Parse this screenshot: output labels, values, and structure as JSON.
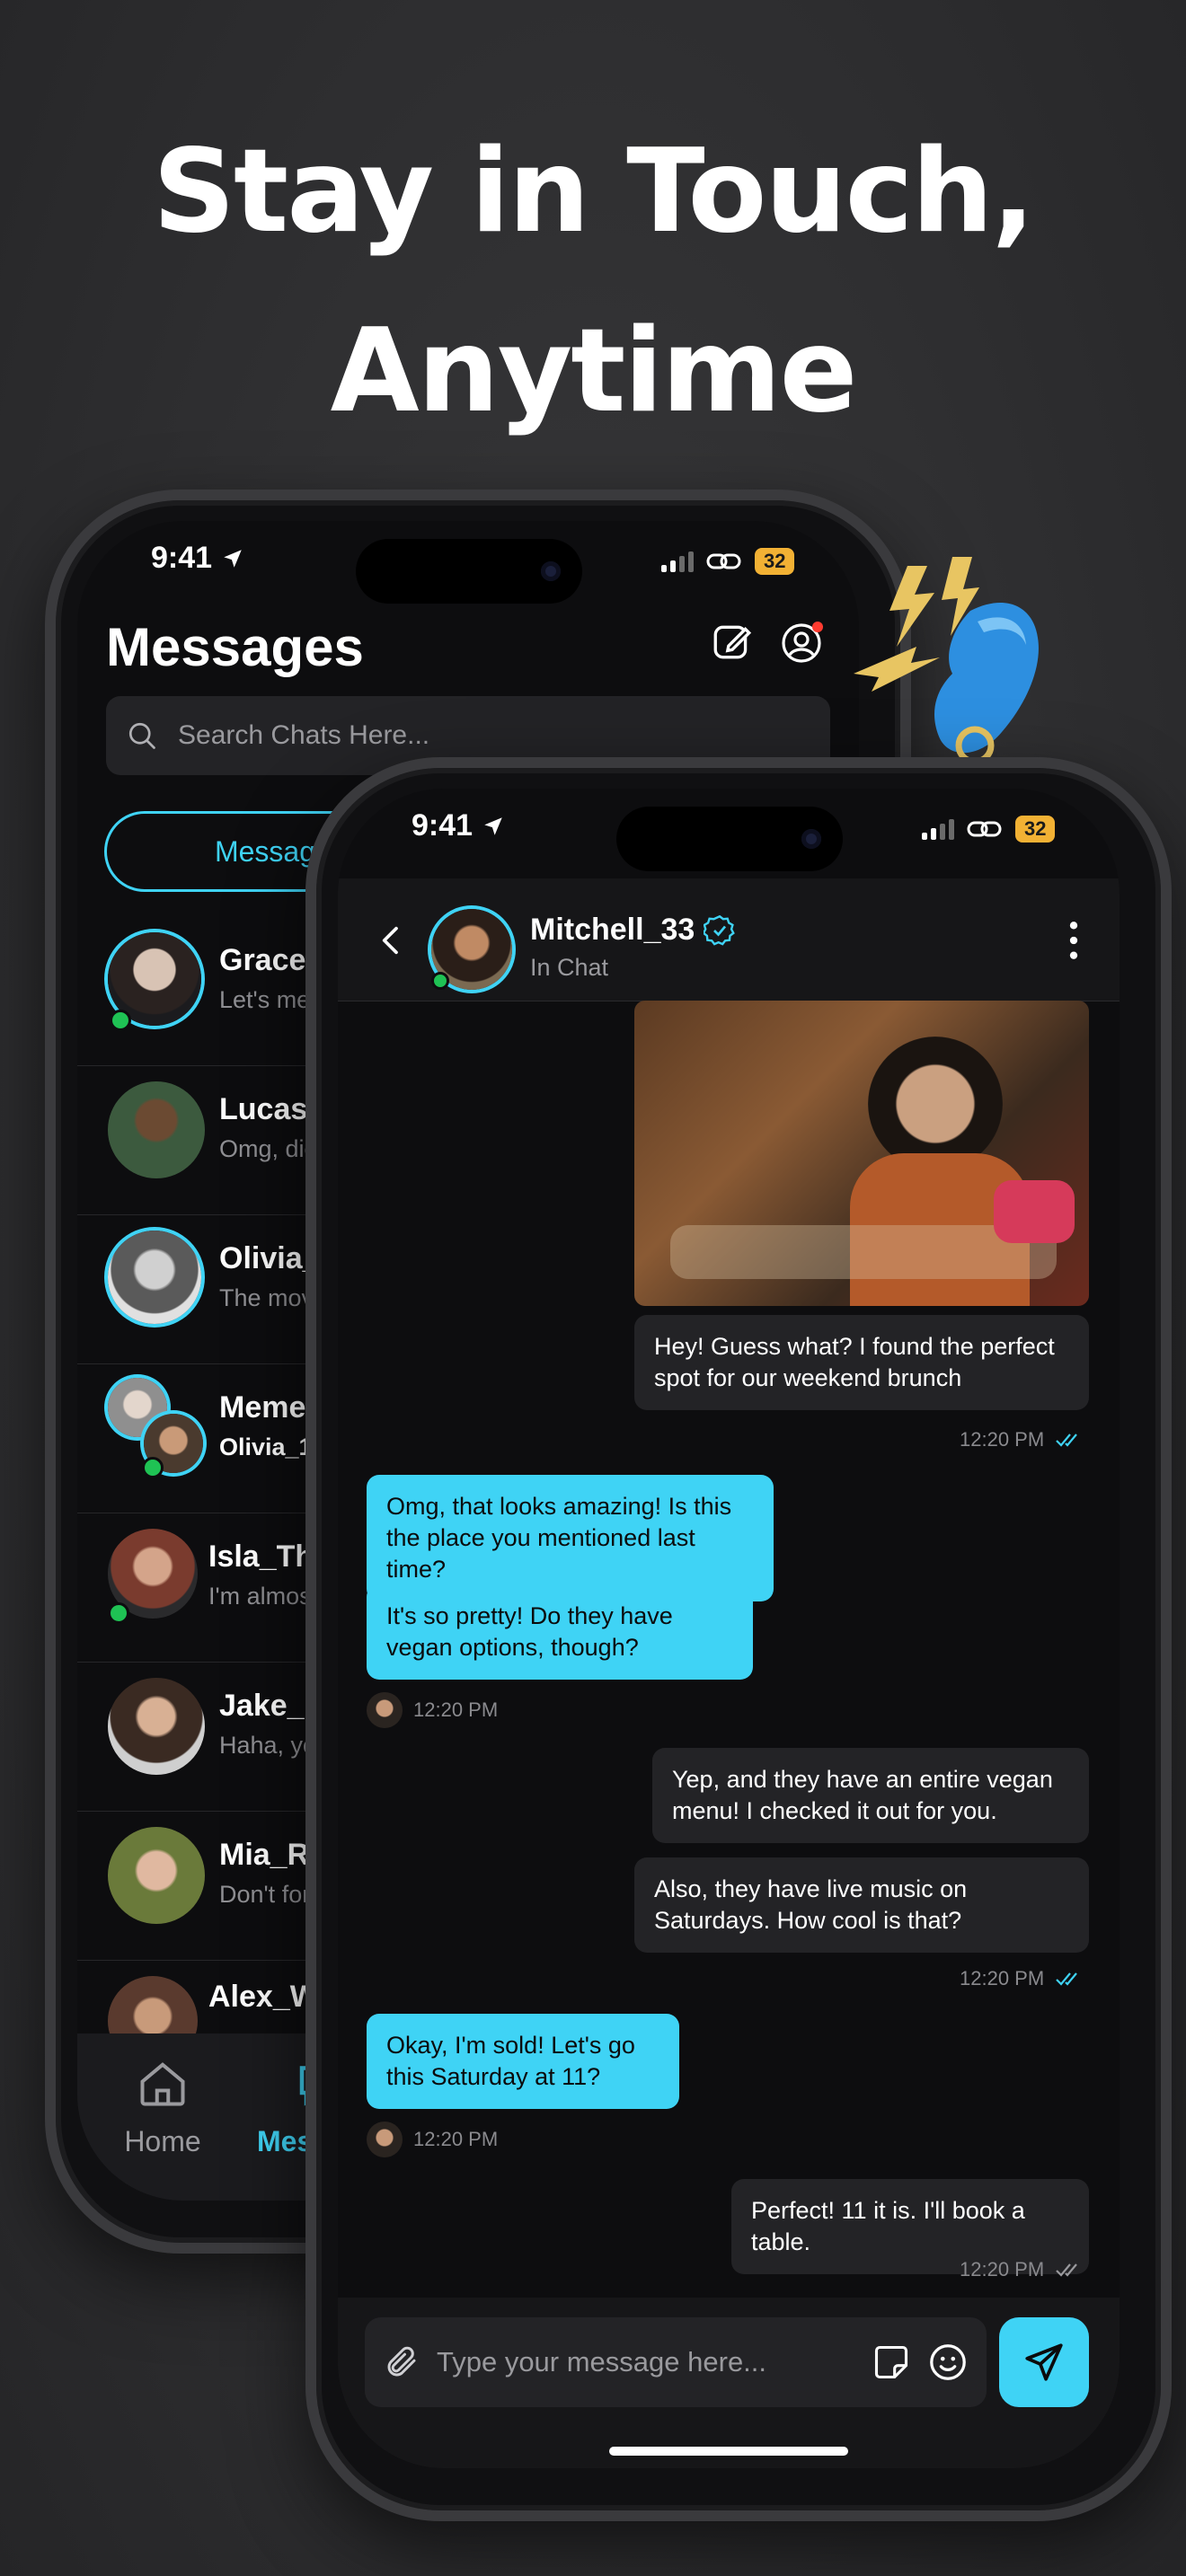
{
  "headline": {
    "line1": "Stay in Touch,",
    "line2": "Anytime"
  },
  "back_phone": {
    "status": {
      "time": "9:41",
      "battery": "32"
    },
    "title": "Messages",
    "search_placeholder": "Search Chats Here...",
    "filter_pill": "Messag",
    "chats": [
      {
        "name": "Grace_",
        "preview": "Let's me",
        "online": true
      },
      {
        "name": "Lucas_",
        "preview": "Omg, dic",
        "online": false
      },
      {
        "name": "Olivia_",
        "preview": "The mov",
        "online": false
      },
      {
        "name": "Meme",
        "preview": "Olivia_1",
        "online": true
      },
      {
        "name": "Isla_Th",
        "preview": "I'm almos",
        "online": true
      },
      {
        "name": "Jake_l",
        "preview": "Haha, yo",
        "online": false
      },
      {
        "name": "Mia_R",
        "preview": "Don't for",
        "online": false
      },
      {
        "name": "Alex_W",
        "preview": "",
        "online": false
      }
    ],
    "tabs": {
      "home": "Home",
      "messages": "Mes"
    }
  },
  "front_phone": {
    "status": {
      "time": "9:41",
      "battery": "32"
    },
    "contact": {
      "name": "Mitchell_33",
      "status": "In Chat"
    },
    "messages": [
      {
        "from": "them",
        "text": "Hey! Guess what? I found the perfect spot for our weekend brunch",
        "time": "12:20 PM"
      },
      {
        "from": "me",
        "text": "Omg, that looks amazing! Is this the place you mentioned last time?"
      },
      {
        "from": "me",
        "text": "It's so pretty! Do they have vegan options, though?",
        "time": "12:20 PM"
      },
      {
        "from": "them",
        "text": "Yep, and they have an entire vegan menu! I checked it out for you."
      },
      {
        "from": "them",
        "text": "Also, they have live music on Saturdays. How cool is that?",
        "time": "12:20 PM"
      },
      {
        "from": "me",
        "text": "Okay, I'm sold! Let's go this Saturday at 11?",
        "time": "12:20 PM"
      },
      {
        "from": "them",
        "text": "Perfect! 11 it is. I'll book a table.",
        "time": "12:20 PM"
      }
    ],
    "composer_placeholder": "Type your message here..."
  },
  "colors": {
    "accent": "#3fd3f5",
    "online": "#1fc254",
    "battery": "#f2b134"
  },
  "icons": [
    "location-arrow-icon",
    "signal-icon",
    "link-icon",
    "compose-icon",
    "profile-icon",
    "search-icon",
    "home-icon",
    "chat-icon",
    "back-chevron-icon",
    "verified-badge-icon",
    "more-vertical-icon",
    "double-check-icon",
    "paperclip-icon",
    "sticker-icon",
    "emoji-icon",
    "send-icon",
    "whistle-icon"
  ]
}
